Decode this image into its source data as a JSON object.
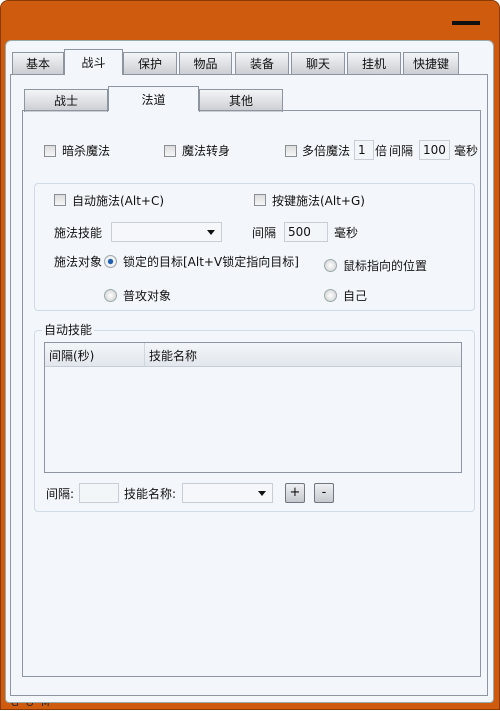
{
  "window": {
    "status_text": "G O M",
    "minimize": "minimize"
  },
  "main_tabs": [
    {
      "label": "基本"
    },
    {
      "label": "战斗",
      "selected": true
    },
    {
      "label": "保护"
    },
    {
      "label": "物品"
    },
    {
      "label": "装备"
    },
    {
      "label": "聊天"
    },
    {
      "label": "挂机"
    },
    {
      "label": "快捷键"
    }
  ],
  "sub_tabs": [
    {
      "label": "战士"
    },
    {
      "label": "法道",
      "selected": true
    },
    {
      "label": "其他"
    }
  ],
  "options": {
    "assassin_magic": "暗杀魔法",
    "magic_transform": "魔法转身",
    "multi_magic": "多倍魔法",
    "multiplier_value": "1",
    "multiplier_unit": "倍",
    "interval_label": "间隔",
    "interval_value": "100",
    "ms": "毫秒"
  },
  "cast": {
    "auto_cast": "自动施法(Alt+C)",
    "key_cast": "按键施法(Alt+G)",
    "skill_label": "施法技能",
    "skill_value": "",
    "interval_label": "间隔",
    "interval_value": "500",
    "ms": "毫秒",
    "target_label": "施法对象",
    "targets": [
      {
        "label": "锁定的目标[Alt+V锁定指向目标]",
        "checked": true
      },
      {
        "label": "鼠标指向的位置",
        "checked": false
      },
      {
        "label": "普攻对象",
        "checked": false
      },
      {
        "label": "自己",
        "checked": false
      }
    ]
  },
  "auto_skills": {
    "legend": "自动技能",
    "columns": [
      "间隔(秒)",
      "技能名称"
    ],
    "rows": [],
    "interval_label": "间隔:",
    "interval_value": "",
    "name_label": "技能名称:",
    "name_value": "",
    "add": "+",
    "remove": "-"
  }
}
